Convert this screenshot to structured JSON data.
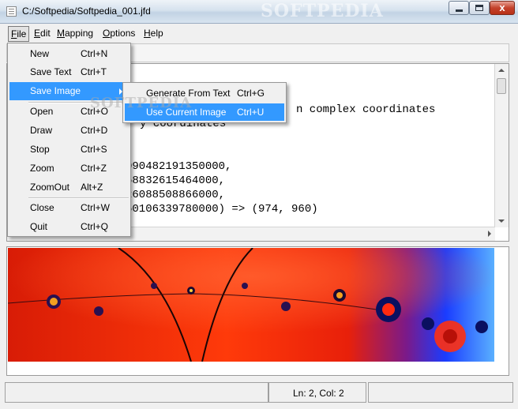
{
  "window": {
    "title": "C:/Softpedia/Softpedia_001.jfd",
    "watermark": "SOFTPEDIA",
    "close_glyph": "x"
  },
  "menubar": {
    "file_key": "F",
    "file_rest": "ile",
    "edit_key": "E",
    "edit_rest": "dit",
    "mapping_key": "M",
    "mapping_rest": "apping",
    "options_key": "O",
    "options_rest": "ptions",
    "help_key": "H",
    "help_rest": "elp"
  },
  "editor": {
    "lines": [
      "n complex coordinates",
      "y coordinates",
      "090482191350000,",
      "58832615464000,",
      "26088508866000,",
      "50106339780000) => (974, 960)"
    ]
  },
  "file_menu": {
    "items": [
      {
        "label": "New",
        "shortcut": "Ctrl+N"
      },
      {
        "label": "Save Text",
        "shortcut": "Ctrl+T"
      },
      {
        "label": "Save Image",
        "shortcut": ""
      },
      {
        "label": "Open",
        "shortcut": "Ctrl+O"
      },
      {
        "label": "Draw",
        "shortcut": "Ctrl+D"
      },
      {
        "label": "Stop",
        "shortcut": "Ctrl+S"
      },
      {
        "label": "Zoom",
        "shortcut": "Ctrl+Z"
      },
      {
        "label": "ZoomOut",
        "shortcut": "Alt+Z"
      },
      {
        "label": "Close",
        "shortcut": "Ctrl+W"
      },
      {
        "label": "Quit",
        "shortcut": "Ctrl+Q"
      }
    ]
  },
  "save_image_submenu": {
    "items": [
      {
        "label": "Generate From Text",
        "shortcut": "Ctrl+G"
      },
      {
        "label": "Use Current Image",
        "shortcut": "Ctrl+U"
      }
    ]
  },
  "statusbar": {
    "position": "Ln: 2, Col: 2"
  },
  "colors": {
    "highlight": "#3399ff",
    "fractal_red": "#e8200a",
    "fractal_blue": "#1a3cff"
  }
}
